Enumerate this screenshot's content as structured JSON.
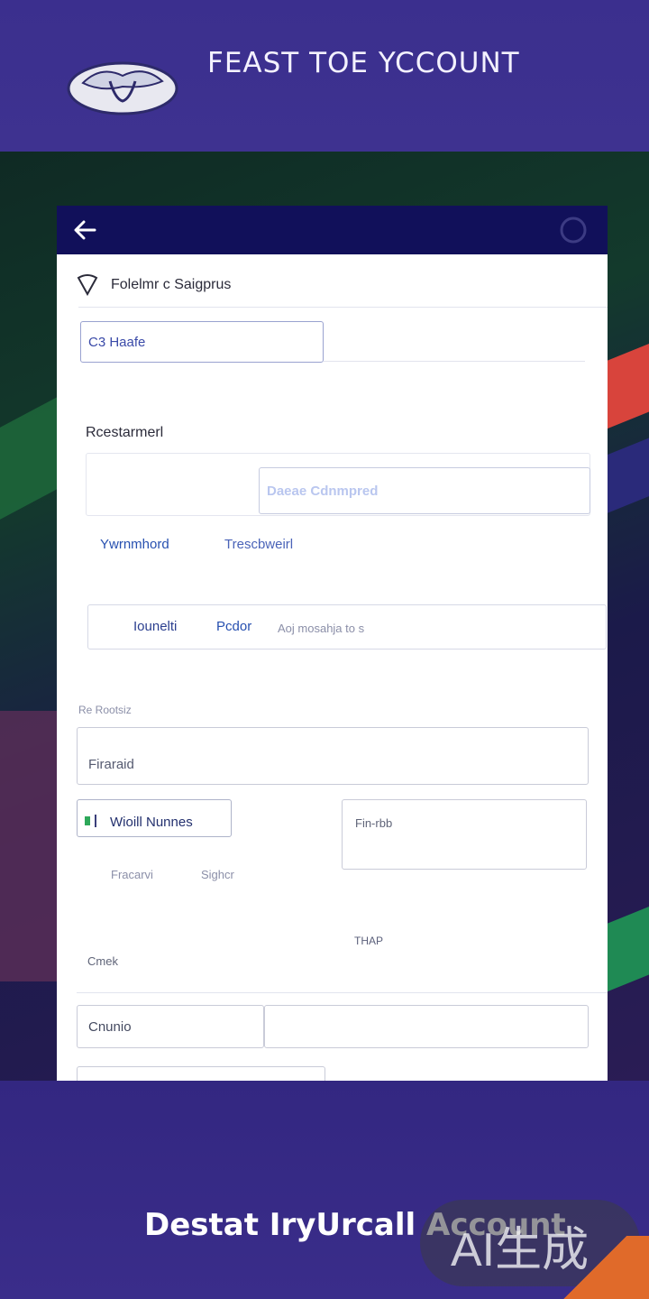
{
  "header": {
    "title": "FEAST TOE YCCOUNT",
    "logo_icon": "eagle-logo"
  },
  "appbar": {
    "back_icon": "arrow-left-icon"
  },
  "form": {
    "section_label": "Folelmr c Saigprus",
    "first_input_value": "C3 Haafe",
    "restore_label": "Rcestarmerl",
    "restore_input_value": "Daeae Cdnmpred",
    "link_left": "Ywrnmhord",
    "link_right": "Trescbweirl",
    "tab_one": "Iounelti",
    "tab_two": "Pcdor",
    "tab_hint": "Aoj mosahja to s",
    "small_label_1": "Re Rootsiz",
    "firstname_value": "Firaraid",
    "badge_label": "Wioill Nunnes",
    "side_field_label": "Fin-rbb",
    "sub_link_1": "Fracarvi",
    "sub_link_2": "Sighcr",
    "small_label_2": "THAP",
    "email_label": "Cmek",
    "country_value": "Cnunio"
  },
  "footer": {
    "text": "Destat IryUrcall Account",
    "watermark": "AI生成"
  }
}
